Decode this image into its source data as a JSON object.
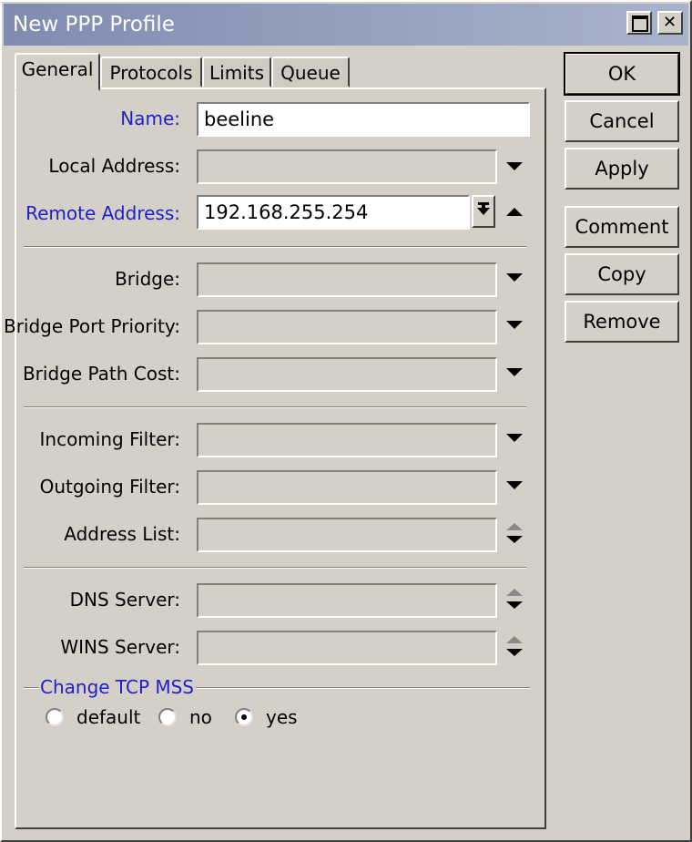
{
  "window": {
    "title": "New PPP Profile"
  },
  "tabs": [
    {
      "label": "General"
    },
    {
      "label": "Protocols"
    },
    {
      "label": "Limits"
    },
    {
      "label": "Queue"
    }
  ],
  "fields": {
    "name": {
      "label": "Name:",
      "value": "beeline"
    },
    "local_address": {
      "label": "Local Address:",
      "value": ""
    },
    "remote_address": {
      "label": "Remote Address:",
      "value": "192.168.255.254"
    },
    "bridge": {
      "label": "Bridge:",
      "value": ""
    },
    "bridge_port_priority": {
      "label": "Bridge Port Priority:",
      "value": ""
    },
    "bridge_path_cost": {
      "label": "Bridge Path Cost:",
      "value": ""
    },
    "incoming_filter": {
      "label": "Incoming Filter:",
      "value": ""
    },
    "outgoing_filter": {
      "label": "Outgoing Filter:",
      "value": ""
    },
    "address_list": {
      "label": "Address List:",
      "value": ""
    },
    "dns_server": {
      "label": "DNS Server:",
      "value": ""
    },
    "wins_server": {
      "label": "WINS Server:",
      "value": ""
    }
  },
  "tcp_mss": {
    "title": "Change TCP MSS",
    "options": [
      "default",
      "no",
      "yes"
    ],
    "selected": "yes"
  },
  "buttons": {
    "ok": "OK",
    "cancel": "Cancel",
    "apply": "Apply",
    "comment": "Comment",
    "copy": "Copy",
    "remove": "Remove"
  },
  "colors": {
    "title_bar": "#7f8cb0",
    "label_accent": "#2020c8",
    "window_bg": "#d4d0c8"
  }
}
